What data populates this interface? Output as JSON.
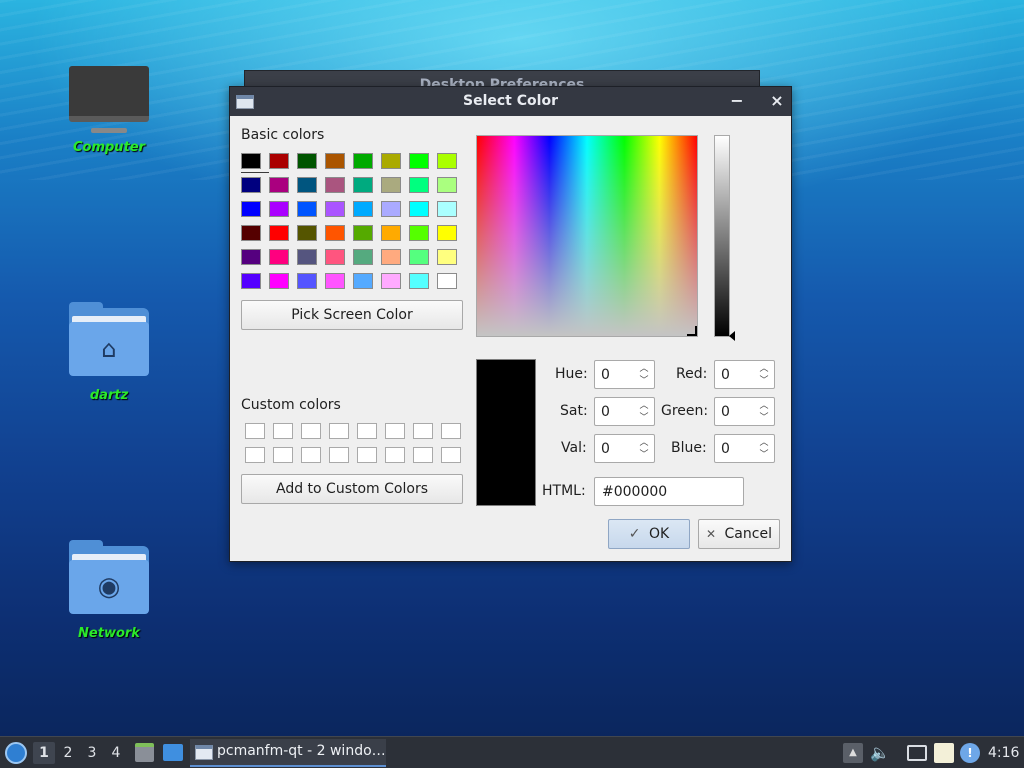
{
  "desktop": {
    "icons": [
      {
        "label": "Computer"
      },
      {
        "label": "dartz"
      },
      {
        "label": "Network"
      }
    ]
  },
  "background_window": {
    "title": "Desktop Preferences"
  },
  "dialog": {
    "title": "Select Color",
    "minimize_glyph": "−",
    "close_glyph": "×",
    "basic_colors_label": "Basic colors",
    "basic_colors": [
      "#000000",
      "#aa0000",
      "#005500",
      "#aa5500",
      "#00aa00",
      "#aaaa00",
      "#00ff00",
      "#aaff00",
      "#00007f",
      "#aa007f",
      "#00557f",
      "#aa557f",
      "#00aa7f",
      "#aaaa7f",
      "#00ff7f",
      "#aaff7f",
      "#0000ff",
      "#aa00ff",
      "#0055ff",
      "#aa55ff",
      "#00aaff",
      "#aaaaff",
      "#00ffff",
      "#aaffff",
      "#550000",
      "#ff0000",
      "#555500",
      "#ff5500",
      "#55aa00",
      "#ffaa00",
      "#55ff00",
      "#ffff00",
      "#55007f",
      "#ff007f",
      "#55557f",
      "#ff557f",
      "#55aa7f",
      "#ffaa7f",
      "#55ff7f",
      "#ffff7f",
      "#5500ff",
      "#ff00ff",
      "#5555ff",
      "#ff55ff",
      "#55aaff",
      "#ffaaff",
      "#55ffff",
      "#ffffff"
    ],
    "pick_screen_color": "Pick Screen Color",
    "custom_colors_label": "Custom colors",
    "add_to_custom": "Add to Custom Colors",
    "current_color": "#000000",
    "fields": {
      "hue": {
        "label": "Hue:",
        "value": "0"
      },
      "sat": {
        "label": "Sat:",
        "value": "0"
      },
      "val": {
        "label": "Val:",
        "value": "0"
      },
      "red": {
        "label": "Red:",
        "value": "0"
      },
      "green": {
        "label": "Green:",
        "value": "0"
      },
      "blue": {
        "label": "Blue:",
        "value": "0"
      },
      "html": {
        "label": "HTML:",
        "value": "#000000"
      }
    },
    "ok_label": "OK",
    "ok_glyph": "✓",
    "cancel_label": "Cancel",
    "cancel_glyph": "✕"
  },
  "taskbar": {
    "workspaces": [
      "1",
      "2",
      "3",
      "4"
    ],
    "active_workspace": "1",
    "task_title": "pcmanfm-qt - 2 windo…",
    "clock": "4:16"
  }
}
